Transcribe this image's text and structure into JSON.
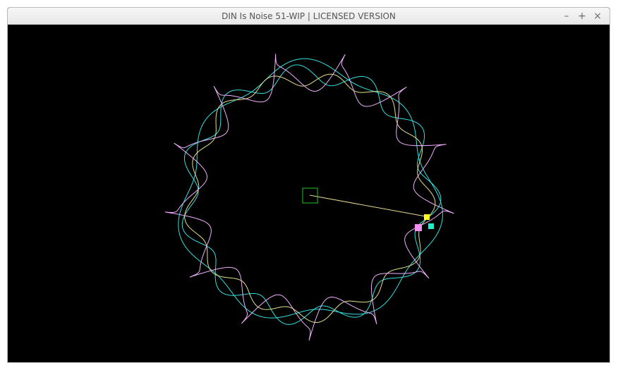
{
  "window": {
    "title": "DIN Is Noise 51-WIP | LICENSED VERSION",
    "controls": {
      "minimize_label": "–",
      "maximize_label": "+",
      "close_label": "×"
    }
  },
  "canvas": {
    "background": "#000000",
    "curves": [
      {
        "name": "violet-curve",
        "color": "#f0b0ff"
      },
      {
        "name": "cyan-curve",
        "color": "#33e0e0"
      },
      {
        "name": "yellow-curve",
        "color": "#e6e08a"
      }
    ],
    "center_handle_color": "#22c322",
    "radius_line_color": "#e8d890",
    "handles": [
      {
        "name": "yellow-handle",
        "color": "#ffff22"
      },
      {
        "name": "cyan-handle",
        "color": "#22eecc"
      },
      {
        "name": "violet-handle",
        "color": "#f090f0"
      }
    ]
  }
}
